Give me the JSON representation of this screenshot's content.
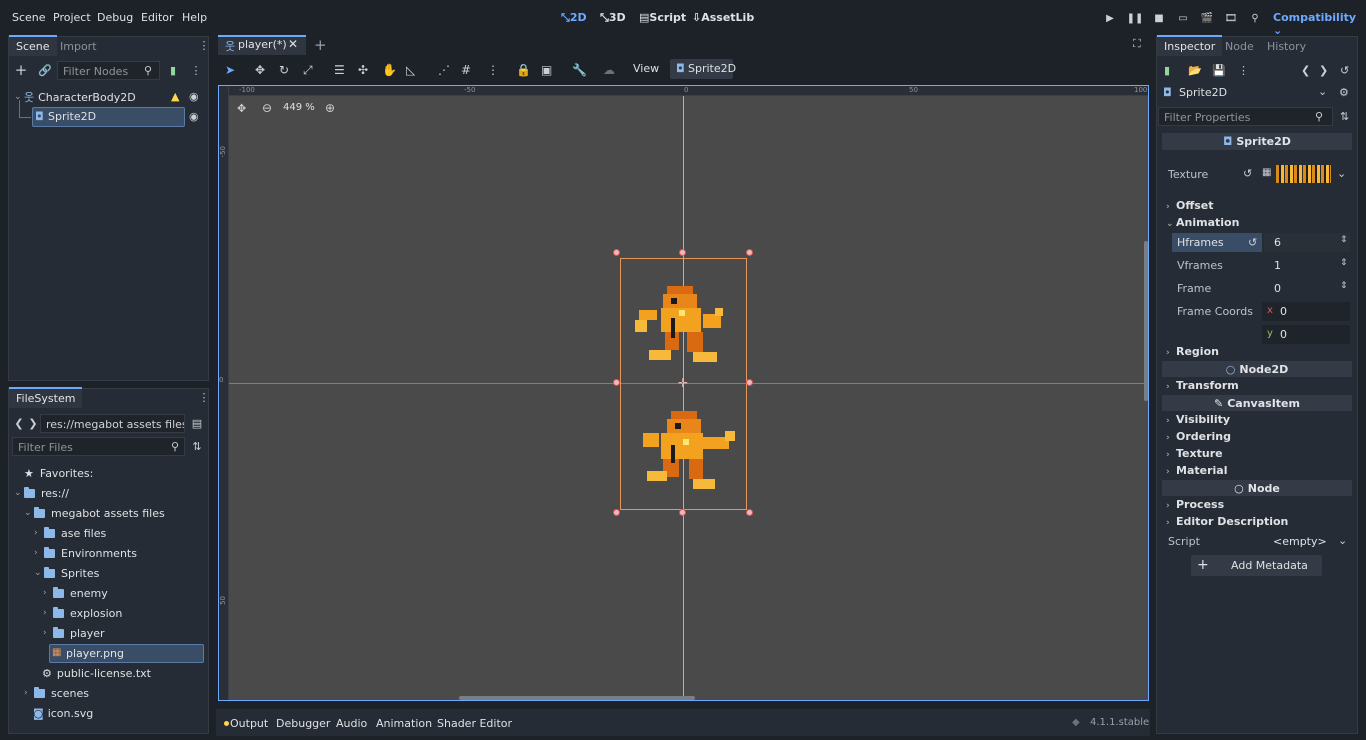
{
  "menu": [
    "Scene",
    "Project",
    "Debug",
    "Editor",
    "Help"
  ],
  "workspaces": {
    "w2d": "2D",
    "w3d": "3D",
    "script": "Script",
    "assetlib": "AssetLib"
  },
  "renderer": "Compatibility",
  "scene_dock": {
    "tabs": {
      "scene": "Scene",
      "import": "Import"
    },
    "filter_placeholder": "Filter Nodes",
    "nodes": {
      "root": "CharacterBody2D",
      "child": "Sprite2D"
    }
  },
  "filesystem_dock": {
    "tab": "FileSystem",
    "path": "res://megabot assets files/Sp",
    "filter_placeholder": "Filter Files",
    "favorites": "Favorites:",
    "items": {
      "res": "res://",
      "megabot": "megabot assets files",
      "ase": "ase files",
      "env": "Environments",
      "sprites": "Sprites",
      "enemy": "enemy",
      "explosion": "explosion",
      "player": "player",
      "player_png": "player.png",
      "license": "public-license.txt",
      "scenes": "scenes",
      "icon": "icon.svg"
    }
  },
  "editor_tabs": {
    "current": "player(*)"
  },
  "toolbar": {
    "view": "View",
    "node": "Sprite2D"
  },
  "viewport": {
    "zoom": "449 %",
    "ruler_h": [
      "-100",
      "-50",
      "0",
      "50",
      "100"
    ],
    "ruler_v": [
      "-50",
      "0",
      "50"
    ]
  },
  "bottom_panel": {
    "tabs": {
      "output": "Output",
      "debugger": "Debugger",
      "audio": "Audio",
      "animation": "Animation",
      "shader": "Shader Editor"
    },
    "version": "4.1.1.stable"
  },
  "inspector": {
    "tabs": {
      "inspector": "Inspector",
      "node": "Node",
      "history": "History"
    },
    "object": "Sprite2D",
    "filter_placeholder": "Filter Properties",
    "sections": {
      "sprite2d": "Sprite2D",
      "node2d": "Node2D",
      "canvasitem": "CanvasItem",
      "node": "Node"
    },
    "texture_label": "Texture",
    "categories": {
      "offset": "Offset",
      "animation": "Animation",
      "region": "Region",
      "transform": "Transform",
      "visibility": "Visibility",
      "ordering": "Ordering",
      "texture": "Texture",
      "material": "Material",
      "process": "Process",
      "editor_desc": "Editor Description"
    },
    "props": {
      "hframes_label": "Hframes",
      "hframes": "6",
      "vframes_label": "Vframes",
      "vframes": "1",
      "frame_label": "Frame",
      "frame": "0",
      "coords_label": "Frame Coords",
      "x_lbl": "x",
      "x": "0",
      "y_lbl": "y",
      "y": "0"
    },
    "script_label": "Script",
    "script_value": "<empty>",
    "add_metadata": "Add Metadata"
  },
  "colors": {
    "accent": "#6fa8ff",
    "warning": "#ffd84a",
    "selection": "#e8955a"
  }
}
